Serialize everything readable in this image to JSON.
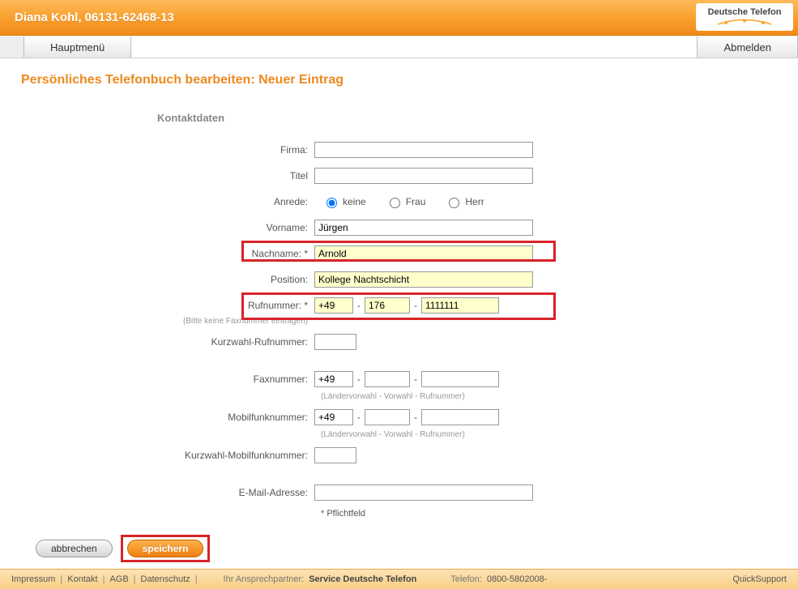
{
  "header": {
    "user_line": "Diana Kohl, 06131-62468-13",
    "logo_text": "Deutsche Telefon"
  },
  "menu": {
    "main": "Hauptmenü",
    "logout": "Abmelden"
  },
  "page": {
    "title": "Persönliches Telefonbuch bearbeiten: Neuer Eintrag",
    "section": "Kontaktdaten"
  },
  "labels": {
    "firma": "Firma:",
    "titel": "Titel",
    "anrede": "Anrede:",
    "vorname": "Vorname:",
    "nachname": "Nachname: *",
    "position": "Position:",
    "rufnummer": "Rufnummer: *",
    "rufnummer_note": "(Bitte keine Faxnummer eintragen)",
    "kurzwahl_ruf": "Kurzwahl-Rufnummer:",
    "fax": "Faxnummer:",
    "mobil": "Mobilfunknummer:",
    "kurzwahl_mobil": "Kurzwahl-Mobilfunknummer:",
    "email": "E-Mail-Adresse:",
    "pflicht": "* Pflichtfeld",
    "phone_hint": "(Ländervorwahl - Vorwahl - Rufnummer)"
  },
  "anrede": {
    "keine": "keine",
    "frau": "Frau",
    "herr": "Herr",
    "selected": "keine"
  },
  "values": {
    "firma": "",
    "titel": "",
    "vorname": "Jürgen",
    "nachname": "Arnold",
    "position": "Kollege Nachtschicht",
    "ruf_cc": "+49",
    "ruf_area": "176",
    "ruf_num": "1111111",
    "kurzwahl_ruf": "",
    "fax_cc": "+49",
    "fax_area": "",
    "fax_num": "",
    "mobil_cc": "+49",
    "mobil_area": "",
    "mobil_num": "",
    "kurzwahl_mobil": "",
    "email": ""
  },
  "buttons": {
    "cancel": "abbrechen",
    "save": "speichern"
  },
  "footer": {
    "impressum": "Impressum",
    "kontakt": "Kontakt",
    "agb": "AGB",
    "datenschutz": "Datenschutz",
    "contact_label": "Ihr Ansprechpartner:",
    "contact_value": "Service Deutsche Telefon",
    "phone_label": "Telefon:",
    "phone_value": "0800-5802008-",
    "quicksupport": "QuickSupport"
  }
}
